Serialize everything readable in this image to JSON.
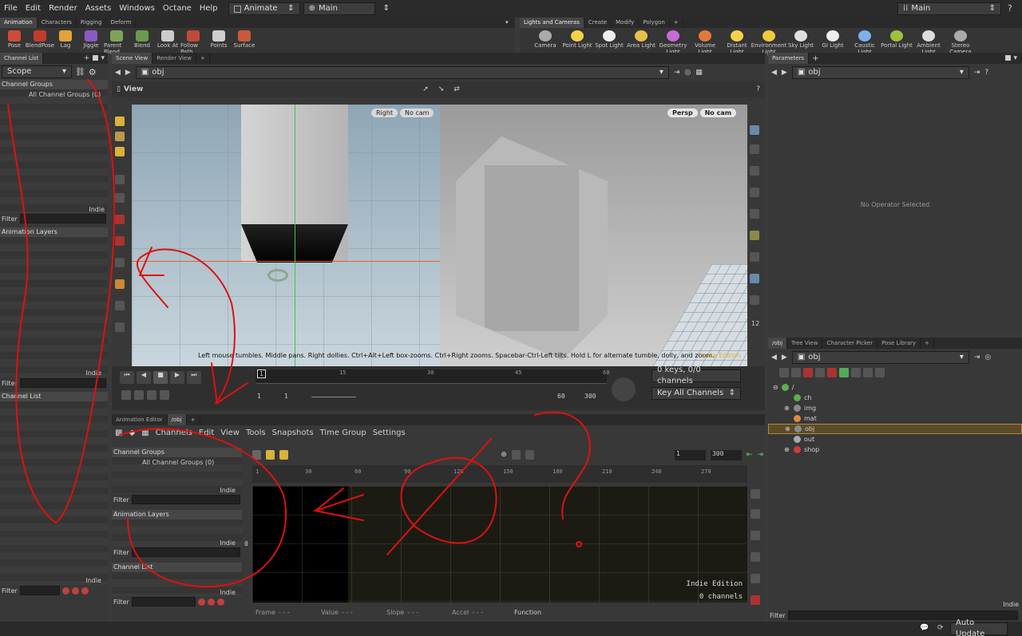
{
  "menu": [
    "File",
    "Edit",
    "Render",
    "Assets",
    "Windows",
    "Octane",
    "Help"
  ],
  "desktop": "Animate",
  "context": "Main",
  "top_right_context": "Main",
  "shelf_left_tabs": [
    "Animation",
    "Characters",
    "Rigging",
    "Deform"
  ],
  "shelf_left_tools": [
    {
      "label": "Pose",
      "color": "#d04a3a"
    },
    {
      "label": "BlendPose",
      "color": "#c23b2f"
    },
    {
      "label": "Lag",
      "color": "#e0a43a"
    },
    {
      "label": "Jiggle",
      "color": "#8a5ac2"
    },
    {
      "label": "Parent Blend",
      "color": "#7fa35a"
    },
    {
      "label": "Blend",
      "color": "#6a9a4e"
    },
    {
      "label": "Look At",
      "color": "#cccccc"
    },
    {
      "label": "Follow Path",
      "color": "#c04a3a"
    },
    {
      "label": "Points",
      "color": "#cfcfcf"
    },
    {
      "label": "Surface",
      "color": "#c85a3a"
    }
  ],
  "shelf_right_tabs": [
    "Lights and Cameras",
    "Create",
    "Modify",
    "Polygon"
  ],
  "shelf_right_tools": [
    {
      "label": "Camera",
      "color": "#aaaaaa"
    },
    {
      "label": "Point Light",
      "color": "#f2d24a"
    },
    {
      "label": "Spot Light",
      "color": "#eeeeee"
    },
    {
      "label": "Area Light",
      "color": "#e6c14a"
    },
    {
      "label": "Geometry Light",
      "color": "#c86ad8"
    },
    {
      "label": "Volume Light",
      "color": "#e07a3a"
    },
    {
      "label": "Distant Light",
      "color": "#f2d24a"
    },
    {
      "label": "Environment Light",
      "color": "#f0cc3a"
    },
    {
      "label": "Sky Light",
      "color": "#e0e0e0"
    },
    {
      "label": "GI Light",
      "color": "#eeeeee"
    },
    {
      "label": "Caustic Light",
      "color": "#7fb0e8"
    },
    {
      "label": "Portal Light",
      "color": "#a0c040"
    },
    {
      "label": "Ambient Light",
      "color": "#dddddd"
    },
    {
      "label": "Stereo Camera",
      "color": "#aaaaaa"
    }
  ],
  "left_panel": {
    "tab": "Channel List",
    "scope": "Scope",
    "channel_groups": "Channel Groups",
    "all_channel_groups": "All Channel Groups (0)",
    "indie": "Indie",
    "filter": "Filter",
    "animation_layers": "Animation Layers",
    "channel_list": "Channel List"
  },
  "viewer": {
    "tabs": [
      "Scene View",
      "Render View"
    ],
    "path": "obj",
    "title": "View",
    "left_view_pill": "Right",
    "left_cam_pill": "No cam",
    "right_view_pill": "Persp",
    "right_cam_pill": "No cam",
    "hint": "Left mouse tumbles. Middle pans. Right dollies. Ctrl+Alt+Left box-zooms. Ctrl+Right zooms. Spacebar-Ctrl-Left tilts. Hold L for alternate tumble, dolly, and zoom.",
    "edition": "Indie Edition",
    "left_icon_number": "12"
  },
  "timeline": {
    "current_frame": "1",
    "ticks": [
      "15",
      "30",
      "45",
      "60"
    ],
    "start": "1",
    "start2": "1",
    "end": "60",
    "end2": "300",
    "keys_info": "0 keys, 0/0 channels",
    "key_all": "Key All Channels"
  },
  "anim_editor": {
    "tabs": [
      "Animation Editor",
      "/obj"
    ],
    "menu": [
      "Channels",
      "Edit",
      "View",
      "Tools",
      "Snapshots",
      "Time Group",
      "Settings"
    ],
    "channel_groups": "Channel Groups",
    "all_channel_groups": "All Channel Groups (0)",
    "indie": "Indie",
    "filter": "Filter",
    "animation_layers": "Animation Layers",
    "channel_list": "Channel List",
    "range_start": "1",
    "range_end": "300",
    "ruler": [
      "1",
      "30",
      "60",
      "90",
      "120",
      "150",
      "180",
      "210",
      "240",
      "270"
    ],
    "zero_label": "0",
    "edition": "Indie Edition",
    "channels": "0 channels",
    "fields": [
      {
        "label": "Frame",
        "value": "- - -"
      },
      {
        "label": "Value",
        "value": "- - -"
      },
      {
        "label": "Slope",
        "value": "- - -"
      },
      {
        "label": "Accel",
        "value": "- - -"
      }
    ],
    "function_label": "Function"
  },
  "params": {
    "tab": "Parameters",
    "path": "obj",
    "empty": "No Operator Selected"
  },
  "network": {
    "tabs": [
      "/obj",
      "Tree View",
      "Character Picker",
      "Pose Library"
    ],
    "path": "obj",
    "root": "/",
    "nodes": [
      {
        "label": "ch",
        "color": "#5ab04a"
      },
      {
        "label": "img",
        "color": "#8a8a8a"
      },
      {
        "label": "mat",
        "color": "#e08a3a"
      },
      {
        "label": "obj",
        "color": "#8a8a8a"
      },
      {
        "label": "out",
        "color": "#aaaaaa"
      },
      {
        "label": "shop",
        "color": "#d03a3a"
      }
    ],
    "indie": "Indie",
    "filter": "Filter"
  },
  "status": {
    "auto_update": "Auto Update"
  },
  "annotation_color": "#e01010"
}
